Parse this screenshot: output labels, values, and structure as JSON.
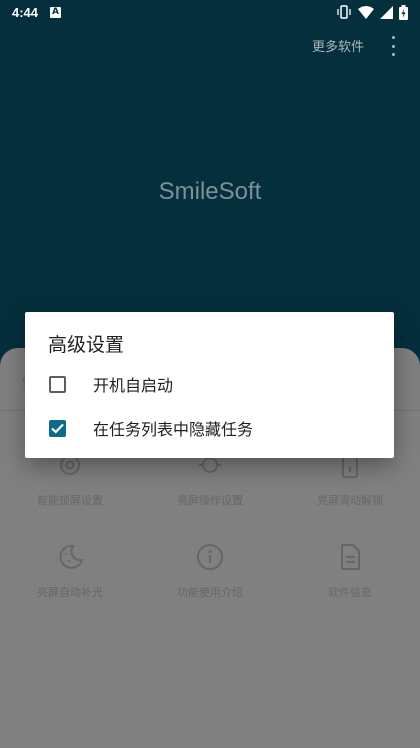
{
  "status_bar": {
    "time": "4:44",
    "notification_letter": "A"
  },
  "toolbar": {
    "more_software": "更多软件"
  },
  "app": {
    "title": "SmileSoft"
  },
  "grid": [
    {
      "label": "智能锁屏设置",
      "icon": "gear-icon"
    },
    {
      "label": "亮屏操作设置",
      "icon": "sun-icon"
    },
    {
      "label": "亮屏滑动解锁",
      "icon": "phone-icon"
    },
    {
      "label": "亮屏自动补光",
      "icon": "moon-icon"
    },
    {
      "label": "功能使用介绍",
      "icon": "info-icon"
    },
    {
      "label": "软件信息",
      "icon": "document-icon"
    }
  ],
  "dialog": {
    "title": "高级设置",
    "options": [
      {
        "label": "开机自启动",
        "checked": false
      },
      {
        "label": "在任务列表中隐藏任务",
        "checked": true
      }
    ]
  },
  "colors": {
    "accent": "#0c6b8a",
    "app_bar": "#052f3d"
  }
}
